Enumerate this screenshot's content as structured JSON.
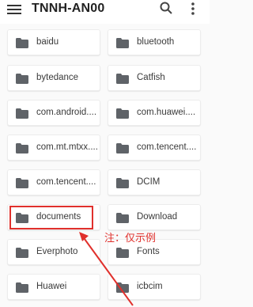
{
  "toolbar": {
    "title": "TNNH-AN00",
    "menu_icon": "hamburger-menu-icon",
    "search_icon": "search-icon",
    "more_icon": "more-vertical-icon"
  },
  "folders": [
    {
      "name": "baidu"
    },
    {
      "name": "bluetooth"
    },
    {
      "name": "bytedance"
    },
    {
      "name": "Catfish"
    },
    {
      "name": "com.android...."
    },
    {
      "name": "com.huawei...."
    },
    {
      "name": "com.mt.mtxx...."
    },
    {
      "name": "com.tencent...."
    },
    {
      "name": "com.tencent...."
    },
    {
      "name": "DCIM"
    },
    {
      "name": "documents"
    },
    {
      "name": "Download"
    },
    {
      "name": "Everphoto"
    },
    {
      "name": "Fonts"
    },
    {
      "name": "Huawei"
    },
    {
      "name": "icbcim"
    }
  ],
  "annotation": {
    "note": "注：仅示例",
    "color": "#e0302c"
  },
  "colors": {
    "background": "#fafafa",
    "card": "#ffffff",
    "folder_icon": "#5f6368"
  }
}
